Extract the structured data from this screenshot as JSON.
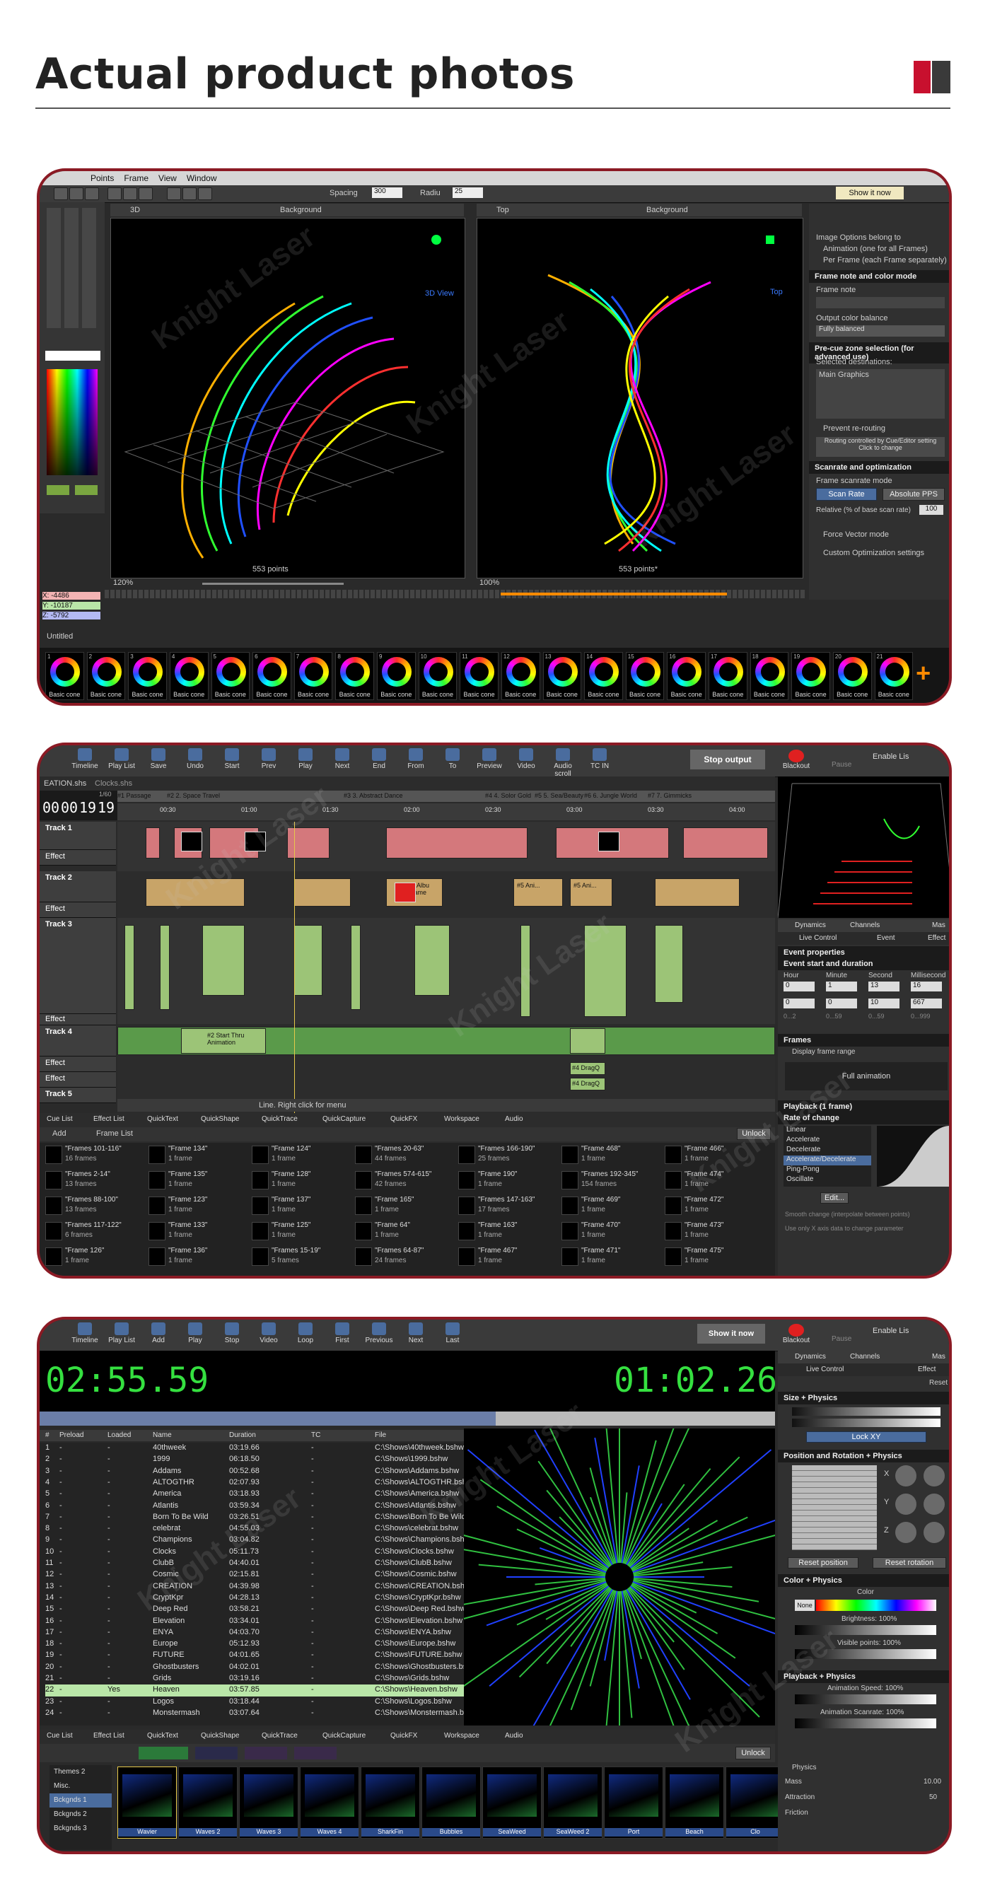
{
  "header": {
    "title": "Actual product photos"
  },
  "shot1": {
    "menu": [
      "Points",
      "Frame",
      "View",
      "Window"
    ],
    "toolbar": {
      "spacing_label": "Spacing",
      "spacing_value": "300",
      "radius_label": "Radiu",
      "radius_value": "25",
      "show_it_now": "Show it now"
    },
    "view_left": {
      "mode": "3D",
      "bg": "Background",
      "label": "3D View",
      "zoom": "120%",
      "points": "553 points"
    },
    "view_right": {
      "mode": "Top",
      "bg": "Background",
      "label": "Top",
      "zoom": "100%",
      "points": "553 points*"
    },
    "coords": {
      "x": "X: -4486",
      "y": "Y: -10187",
      "z": "Z: -5792"
    },
    "doc_name": "Untitled",
    "right_panel": {
      "image_options": "Image Options belong to",
      "opt_animation": "Animation (one for all Frames)",
      "opt_per_frame": "Per Frame (each Frame separately)",
      "frame_note_head": "Frame note and color mode",
      "frame_note": "Frame note",
      "output_balance": "Output color balance",
      "balance_value": "Fully balanced",
      "precue_head": "Pre-cue zone selection (for advanced use)",
      "selected_dest": "Selected destinations:",
      "main_graphics": "Main Graphics",
      "prevent_rerouting": "Prevent re-routing",
      "routing_note_1": "Routing controlled by Cue/Editor setting",
      "routing_note_2": "Click to change",
      "scanrate_head": "Scanrate and optimization",
      "frame_scanrate_mode": "Frame scanrate mode",
      "scan_rate": "Scan Rate",
      "absolute_pps": "Absolute PPS",
      "relative": "Relative (% of base scan rate)",
      "relative_value": "100",
      "force_vector": "Force Vector mode",
      "custom_opt": "Custom Optimization settings"
    },
    "thumbs": [
      {
        "n": "1",
        "label": "Basic cone"
      },
      {
        "n": "2",
        "label": "Basic cone"
      },
      {
        "n": "3",
        "label": "Basic cone"
      },
      {
        "n": "4",
        "label": "Basic cone"
      },
      {
        "n": "5",
        "label": "Basic cone"
      },
      {
        "n": "6",
        "label": "Basic cone"
      },
      {
        "n": "7",
        "label": "Basic cone"
      },
      {
        "n": "8",
        "label": "Basic cone"
      },
      {
        "n": "9",
        "label": "Basic cone"
      },
      {
        "n": "10",
        "label": "Basic cone"
      },
      {
        "n": "11",
        "label": "Basic cone"
      },
      {
        "n": "12",
        "label": "Basic cone"
      },
      {
        "n": "13",
        "label": "Basic cone"
      },
      {
        "n": "14",
        "label": "Basic cone"
      },
      {
        "n": "15",
        "label": "Basic cone"
      },
      {
        "n": "16",
        "label": "Basic cone"
      },
      {
        "n": "17",
        "label": "Basic cone"
      },
      {
        "n": "18",
        "label": "Basic cone"
      },
      {
        "n": "19",
        "label": "Basic cone"
      },
      {
        "n": "20",
        "label": "Basic cone"
      },
      {
        "n": "21",
        "label": "Basic cone"
      }
    ]
  },
  "shot2": {
    "toolbar": [
      "Timeline",
      "Play List",
      "Save",
      "Undo",
      "Start",
      "Prev",
      "Play",
      "Next",
      "End",
      "From",
      "To",
      "Preview",
      "Video",
      "Audio scroll",
      "TC IN"
    ],
    "stop_output": "Stop output",
    "blackout": "Blackout",
    "pause": "Pause",
    "enable": "Enable Lis",
    "tabs": [
      "EATION.shs",
      "Clocks.shs"
    ],
    "timecode": {
      "h": "00",
      "m": "00",
      "s": "19",
      "f": "19",
      "fps": "1/60"
    },
    "markers": [
      "#1 Passage",
      "#2 2. Space Travel",
      "#3 3. Abstract Dance",
      "#4 4. Solor Gold",
      "#5 5. Sea/Beauty",
      "#6 6. Jungle World",
      "#7 7. Gimmicks"
    ],
    "ruler": [
      "00:30",
      "01:00",
      "01:30",
      "02:00",
      "02:30",
      "03:00",
      "03:30",
      "04:00"
    ],
    "tracks": [
      {
        "name": "Track 1",
        "effect": "Effect"
      },
      {
        "name": "Track 2",
        "effect": "Effect"
      },
      {
        "name": "Track 3",
        "effect": "Effect"
      },
      {
        "name": "Track 4",
        "effect": "Effect"
      },
      {
        "name": "Track 5",
        "effect": ""
      }
    ],
    "effect2": "Effect",
    "clip_texts": {
      "t2a": "#2 Albu Frame",
      "t2b": "#5 Ani...",
      "t2c": "#5 Ani...",
      "t4a": "#2 Start Thru Animation",
      "t4b": "#4 DragQ",
      "t4c": "#4 DragQ"
    },
    "status": "Line. Right click for menu",
    "bottom_tabs": [
      "Cue List",
      "Effect List",
      "QuickText",
      "QuickShape",
      "QuickTrace",
      "QuickCapture",
      "QuickFX",
      "Workspace",
      "Audio"
    ],
    "add": "Add",
    "frame_list": "Frame List",
    "unlock": "Unlock",
    "cues": [
      {
        "l": "\"Frames 101-116\"",
        "s": "16 frames"
      },
      {
        "l": "\"Frames 2-14\"",
        "s": "13 frames"
      },
      {
        "l": "\"Frames 88-100\"",
        "s": "13 frames"
      },
      {
        "l": "\"Frames 117-122\"",
        "s": "6 frames"
      },
      {
        "l": "\"Frame 126\"",
        "s": "1 frame"
      },
      {
        "l": "\"Frame 134\"",
        "s": "1 frame"
      },
      {
        "l": "\"Frame 135\"",
        "s": "1 frame"
      },
      {
        "l": "\"Frame 123\"",
        "s": "1 frame"
      },
      {
        "l": "\"Frame 133\"",
        "s": "1 frame"
      },
      {
        "l": "\"Frame 136\"",
        "s": "1 frame"
      },
      {
        "l": "\"Frame 124\"",
        "s": "1 frame"
      },
      {
        "l": "\"Frame 128\"",
        "s": "1 frame"
      },
      {
        "l": "\"Frame 137\"",
        "s": "1 frame"
      },
      {
        "l": "\"Frame 125\"",
        "s": "1 frame"
      },
      {
        "l": "\"Frames 15-19\"",
        "s": "5 frames"
      },
      {
        "l": "\"Frames 20-63\"",
        "s": "44 frames"
      },
      {
        "l": "\"Frames 574-615\"",
        "s": "42 frames"
      },
      {
        "l": "\"Frame 165\"",
        "s": "1 frame"
      },
      {
        "l": "\"Frame 64\"",
        "s": "1 frame"
      },
      {
        "l": "\"Frames 64-87\"",
        "s": "24 frames"
      },
      {
        "l": "\"Frames 166-190\"",
        "s": "25 frames"
      },
      {
        "l": "\"Frame 190\"",
        "s": "1 frame"
      },
      {
        "l": "\"Frames 147-163\"",
        "s": "17 frames"
      },
      {
        "l": "\"Frame 163\"",
        "s": "1 frame"
      },
      {
        "l": "\"Frame 467\"",
        "s": "1 frame"
      },
      {
        "l": "\"Frame 468\"",
        "s": "1 frame"
      },
      {
        "l": "\"Frames 192-345\"",
        "s": "154 frames"
      },
      {
        "l": "\"Frame 469\"",
        "s": "1 frame"
      },
      {
        "l": "\"Frame 470\"",
        "s": "1 frame"
      },
      {
        "l": "\"Frame 471\"",
        "s": "1 frame"
      },
      {
        "l": "\"Frame 466\"",
        "s": "1 frame"
      },
      {
        "l": "\"Frame 474\"",
        "s": "1 frame"
      },
      {
        "l": "\"Frame 472\"",
        "s": "1 frame"
      },
      {
        "l": "\"Frame 473\"",
        "s": "1 frame"
      },
      {
        "l": "\"Frame 475\"",
        "s": "1 frame"
      }
    ],
    "right": {
      "tabs": [
        "Dynamics",
        "Channels",
        "Mas"
      ],
      "subtabs": [
        "Live Control",
        "Event",
        "Effect"
      ],
      "event_props": "Event properties",
      "event_start": "Event start and duration",
      "cols": [
        "Hour",
        "Minute",
        "Second",
        "Millisecond"
      ],
      "row1": [
        "0",
        "1",
        "13",
        "16"
      ],
      "row2": [
        "0",
        "0",
        "10",
        "667"
      ],
      "ranges": [
        "0...2",
        "0...59",
        "0...59",
        "0...999"
      ],
      "frames_head": "Frames",
      "display_range": "Display frame range",
      "full_anim": "Full animation",
      "playback_head": "Playback (1 frame)",
      "rate_head": "Rate of change",
      "rates": [
        "Linear",
        "Accelerate",
        "Decelerate",
        "Accelerate/Decelerate",
        "Ping-Pong",
        "Oscillate"
      ],
      "edit": "Edit...",
      "smooth": "Smooth change (interpolate between points)",
      "use_x": "Use only X axis data to change parameter"
    }
  },
  "shot3": {
    "toolbar": [
      "Timeline",
      "Play List",
      "Add",
      "Play",
      "Stop",
      "Video",
      "Loop",
      "First",
      "Previous",
      "Next",
      "Last"
    ],
    "show_it_now": "Show it now",
    "blackout": "Blackout",
    "pause": "Pause",
    "enable": "Enable Lis",
    "elapsed": "02:55.59",
    "remaining": "01:02.26",
    "progress": 0.62,
    "columns": [
      "#",
      "Preload",
      "Loaded",
      "Name",
      "Duration",
      "TC",
      "File"
    ],
    "rows": [
      {
        "n": "1",
        "p": "-",
        "l": "-",
        "name": "40thweek",
        "d": "03:19.66",
        "tc": "-",
        "f": "C:\\Shows\\40thweek.bshw"
      },
      {
        "n": "2",
        "p": "-",
        "l": "-",
        "name": "1999",
        "d": "06:18.50",
        "tc": "-",
        "f": "C:\\Shows\\1999.bshw"
      },
      {
        "n": "3",
        "p": "-",
        "l": "-",
        "name": "Addams",
        "d": "00:52.68",
        "tc": "-",
        "f": "C:\\Shows\\Addams.bshw"
      },
      {
        "n": "4",
        "p": "-",
        "l": "-",
        "name": "ALTOGTHR",
        "d": "02:07.93",
        "tc": "-",
        "f": "C:\\Shows\\ALTOGTHR.bshw"
      },
      {
        "n": "5",
        "p": "-",
        "l": "-",
        "name": "America",
        "d": "03:18.93",
        "tc": "-",
        "f": "C:\\Shows\\America.bshw"
      },
      {
        "n": "6",
        "p": "-",
        "l": "-",
        "name": "Atlantis",
        "d": "03:59.34",
        "tc": "-",
        "f": "C:\\Shows\\Atlantis.bshw"
      },
      {
        "n": "7",
        "p": "-",
        "l": "-",
        "name": "Born To Be Wild",
        "d": "03:26.51",
        "tc": "-",
        "f": "C:\\Shows\\Born To Be Wild.bsh"
      },
      {
        "n": "8",
        "p": "-",
        "l": "-",
        "name": "celebrat",
        "d": "04:55.03",
        "tc": "-",
        "f": "C:\\Shows\\celebrat.bshw"
      },
      {
        "n": "9",
        "p": "-",
        "l": "-",
        "name": "Champions",
        "d": "03:04.82",
        "tc": "-",
        "f": "C:\\Shows\\Champions.bshw"
      },
      {
        "n": "10",
        "p": "-",
        "l": "-",
        "name": "Clocks",
        "d": "05:11.73",
        "tc": "-",
        "f": "C:\\Shows\\Clocks.bshw"
      },
      {
        "n": "11",
        "p": "-",
        "l": "-",
        "name": "ClubB",
        "d": "04:40.01",
        "tc": "-",
        "f": "C:\\Shows\\ClubB.bshw"
      },
      {
        "n": "12",
        "p": "-",
        "l": "-",
        "name": "Cosmic",
        "d": "02:15.81",
        "tc": "-",
        "f": "C:\\Shows\\Cosmic.bshw"
      },
      {
        "n": "13",
        "p": "-",
        "l": "-",
        "name": "CREATION",
        "d": "04:39.98",
        "tc": "-",
        "f": "C:\\Shows\\CREATION.bshw"
      },
      {
        "n": "14",
        "p": "-",
        "l": "-",
        "name": "CryptKpr",
        "d": "04:28.13",
        "tc": "-",
        "f": "C:\\Shows\\CryptKpr.bshw"
      },
      {
        "n": "15",
        "p": "-",
        "l": "-",
        "name": "Deep Red",
        "d": "03:58.21",
        "tc": "-",
        "f": "C:\\Shows\\Deep Red.bshw"
      },
      {
        "n": "16",
        "p": "-",
        "l": "-",
        "name": "Elevation",
        "d": "03:34.01",
        "tc": "-",
        "f": "C:\\Shows\\Elevation.bshw"
      },
      {
        "n": "17",
        "p": "-",
        "l": "-",
        "name": "ENYA",
        "d": "04:03.70",
        "tc": "-",
        "f": "C:\\Shows\\ENYA.bshw"
      },
      {
        "n": "18",
        "p": "-",
        "l": "-",
        "name": "Europe",
        "d": "05:12.93",
        "tc": "-",
        "f": "C:\\Shows\\Europe.bshw"
      },
      {
        "n": "19",
        "p": "-",
        "l": "-",
        "name": "FUTURE",
        "d": "04:01.65",
        "tc": "-",
        "f": "C:\\Shows\\FUTURE.bshw"
      },
      {
        "n": "20",
        "p": "-",
        "l": "-",
        "name": "Ghostbusters",
        "d": "04:02.01",
        "tc": "-",
        "f": "C:\\Shows\\Ghostbusters.bshw"
      },
      {
        "n": "21",
        "p": "-",
        "l": "-",
        "name": "Grids",
        "d": "03:19.16",
        "tc": "-",
        "f": "C:\\Shows\\Grids.bshw"
      },
      {
        "n": "22",
        "p": "-",
        "l": "Yes",
        "name": "Heaven",
        "d": "03:57.85",
        "tc": "-",
        "f": "C:\\Shows\\Heaven.bshw"
      },
      {
        "n": "23",
        "p": "-",
        "l": "-",
        "name": "Logos",
        "d": "03:18.44",
        "tc": "-",
        "f": "C:\\Shows\\Logos.bshw"
      },
      {
        "n": "24",
        "p": "-",
        "l": "-",
        "name": "Monstermash",
        "d": "03:07.64",
        "tc": "-",
        "f": "C:\\Shows\\Monstermash.bshw"
      }
    ],
    "bottom_tabs": [
      "Cue List",
      "Effect List",
      "QuickText",
      "QuickShape",
      "QuickTrace",
      "QuickCapture",
      "QuickFX",
      "Workspace",
      "Audio"
    ],
    "unlock": "Unlock",
    "ws_list": [
      "Themes 2",
      "Misc.",
      "Bckgnds 1",
      "Bckgnds 2",
      "Bckgnds 3"
    ],
    "ws_thumbs": [
      "Wavier",
      "Waves 2",
      "Waves 3",
      "Waves 4",
      "SharkFin",
      "Bubbles",
      "SeaWeed",
      "SeaWeed 2",
      "Port",
      "Beach",
      "Clo"
    ],
    "right": {
      "tabs": [
        "Dynamics",
        "Channels",
        "Mas"
      ],
      "subtabs": [
        "Live Control",
        "Effect"
      ],
      "reset": "Reset",
      "size_physics": "Size + Physics",
      "lock_xy": "Lock XY",
      "pos_rot": "Position and Rotation + Physics",
      "axes": [
        "X",
        "Y",
        "Z"
      ],
      "reset_position": "Reset position",
      "reset_rotation": "Reset rotation",
      "color_physics": "Color + Physics",
      "color": "Color",
      "none": "None",
      "brightness": "Brightness: 100%",
      "visible_points": "Visible points: 100%",
      "playback_physics": "Playback + Physics",
      "anim_speed": "Animation Speed: 100%",
      "anim_scanrate": "Animation Scanrate: 100%",
      "physics": "Physics",
      "mass": "Mass",
      "mass_val": "10.00",
      "attraction": "Attraction",
      "attr_val": "50",
      "friction": "Friction"
    }
  }
}
